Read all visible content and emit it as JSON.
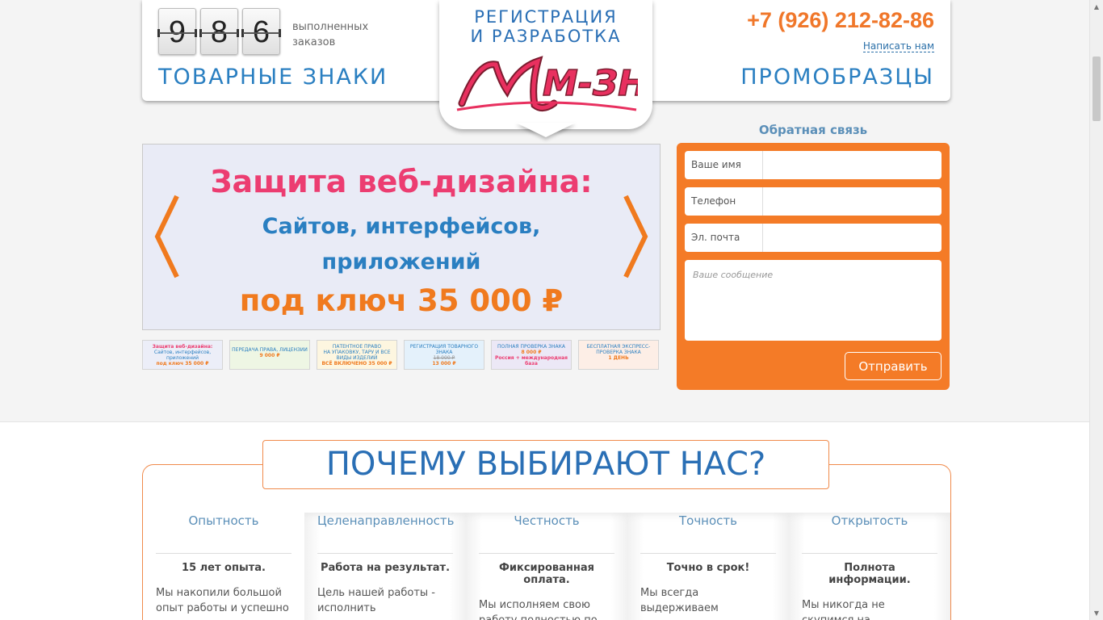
{
  "header": {
    "counter_digits": [
      "9",
      "8",
      "6"
    ],
    "counter_label": "выполненных заказов",
    "brand_left": "ТОВАРНЫЕ ЗНАКИ",
    "brand_right": "ПРОМОБРАЗЦЫ",
    "phone": "+7 (926) 212-82-86",
    "write_us": "Написать нам"
  },
  "logo": {
    "line1": "РЕГИСТРАЦИЯ",
    "line2": "И РАЗРАБОТКА",
    "mark": "М-ЗНАК",
    "mark_color": "#e8305f"
  },
  "slider": {
    "line1": "Защита веб-дизайна:",
    "line2": "Сайтов, интерфейсов,",
    "line3": "приложений",
    "line4": "под ключ 35 000 ₽",
    "arrow_color": "#f07a1e"
  },
  "thumbs": [
    {
      "a": "Защита веб-дизайна:",
      "b": "Сайтов, интерфейсов, приложений",
      "c": "под ключ 35 000 ₽",
      "bg": "#eceef8"
    },
    {
      "a": "ПЕРЕДАЧА ПРАВА, ЛИЦЕНЗИИ",
      "b": "",
      "c": "9 000 ₽",
      "bg": "#eef6e4"
    },
    {
      "a": "ПАТЕНТНОЕ ПРАВО",
      "b": "НА УПАКОВКУ, ТАРУ И ВСЕ ВИДЫ ИЗДЕЛИЙ",
      "c": "ВСЁ ВКЛЮЧЕНО 35 000 ₽",
      "bg": "#fdf6e0"
    },
    {
      "a": "РЕГИСТРАЦИЯ ТОВАРНОГО ЗНАКА",
      "b": "18 000 ₽",
      "c": "13 000 ₽",
      "bg": "#e4f1fb"
    },
    {
      "a": "ПОЛНАЯ ПРОВЕРКА ЗНАКА",
      "b": "8 000 ₽",
      "c": "Россия + международная база",
      "bg": "#ece8f6"
    },
    {
      "a": "БЕСПЛАТНАЯ ЭКСПРЕСС-ПРОВЕРКА ЗНАКА",
      "b": "",
      "c": "1 ДЕНЬ",
      "bg": "#fdeee6"
    }
  ],
  "feedback": {
    "title": "Обратная связь",
    "name_label": "Ваше имя",
    "phone_label": "Телефон",
    "email_label": "Эл. почта",
    "message_placeholder": "Ваше сообщение",
    "send_label": "Отправить",
    "accent": "#f47b27"
  },
  "why": {
    "title": "ПОЧЕМУ ВЫБИРАЮТ НАС?",
    "columns": [
      {
        "head": "Опытность",
        "sub": "15 лет опыта.",
        "text": "Мы накопили большой опыт работы и успешно"
      },
      {
        "head": "Целенаправленность",
        "sub": "Работа на результат.",
        "text": "Цель нашей работы - исполнить поставленную"
      },
      {
        "head": "Честность",
        "sub": "Фиксированная оплата.",
        "text": "Мы исполняем свою работу полностью по"
      },
      {
        "head": "Точность",
        "sub": "Точно в срок!",
        "text": " Мы всегда выдерживаем"
      },
      {
        "head": "Открытость",
        "sub": "Полнота информации.",
        "text": "Мы никогда не скупимся на информацию и"
      }
    ]
  }
}
